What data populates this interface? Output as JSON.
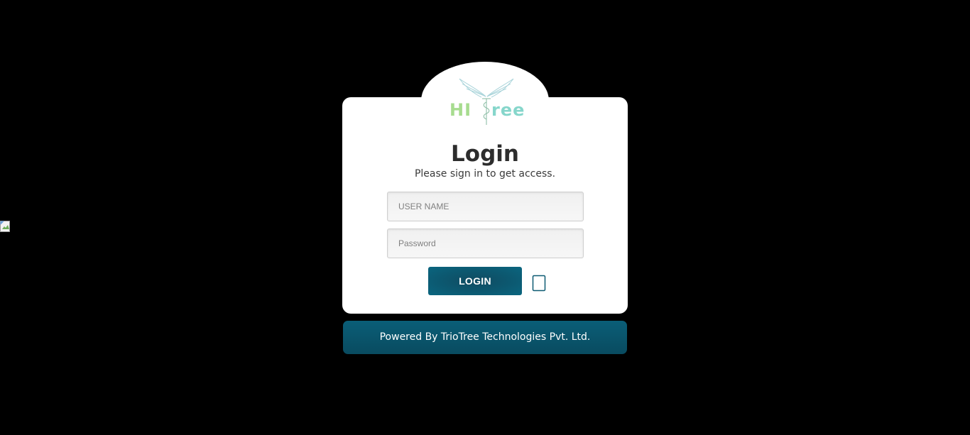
{
  "logo": {
    "text_left": "HI",
    "text_right": "ree"
  },
  "login": {
    "title": "Login",
    "subtitle": "Please sign in to get access.",
    "username_placeholder": "USER NAME",
    "password_placeholder": "Password",
    "button_label": "LOGIN"
  },
  "footer": {
    "text": "Powered By TrioTree Technologies Pvt. Ltd."
  },
  "icons": {
    "logo": "hitree-winged-logo",
    "broken_image": "broken-image-icon",
    "device": "mobile-device-icon"
  },
  "colors": {
    "background": "#000000",
    "card": "#ffffff",
    "accent": "#0a5a72",
    "logo_green": "#a7dc8f",
    "logo_teal": "#86d6cb"
  }
}
